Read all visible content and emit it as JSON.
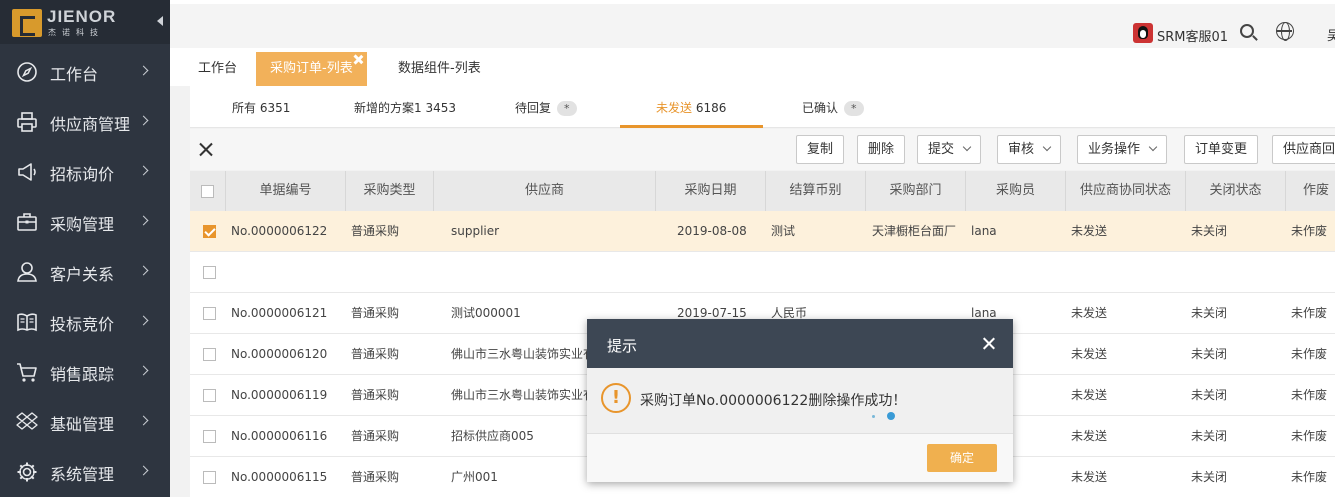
{
  "logo": {
    "name": "JIENOR",
    "subtitle": "杰诺科技"
  },
  "sidebar": {
    "items": [
      {
        "label": "工作台",
        "icon": "compass-icon"
      },
      {
        "label": "供应商管理",
        "icon": "printer-icon"
      },
      {
        "label": "招标询价",
        "icon": "megaphone-icon"
      },
      {
        "label": "采购管理",
        "icon": "briefcase-icon"
      },
      {
        "label": "客户关系",
        "icon": "user-icon"
      },
      {
        "label": "投标竞价",
        "icon": "book-icon"
      },
      {
        "label": "销售跟踪",
        "icon": "cart-icon"
      },
      {
        "label": "基础管理",
        "icon": "dropbox-icon"
      },
      {
        "label": "系统管理",
        "icon": "gear-icon"
      }
    ]
  },
  "topbar": {
    "user": "SRM客服01",
    "cut_text": "吴"
  },
  "pagetabs": {
    "tab1": "工作台",
    "tab2": "采购订单-列表",
    "tab3": "数据组件-列表"
  },
  "filters": {
    "all_label": "所有",
    "all_count": "6351",
    "new_label": "新增的方案1",
    "new_count": "3453",
    "reply_label": "待回复",
    "reply_badge": "*",
    "unsent_label": "未发送",
    "unsent_count": "6186",
    "confirmed_label": "已确认",
    "confirmed_badge": "*"
  },
  "toolbar": {
    "copy": "复制",
    "delete": "删除",
    "submit": "提交",
    "review": "审核",
    "business": "业务操作",
    "change": "订单变更",
    "supplier_cut": "供应商回"
  },
  "table": {
    "headers": [
      "单据编号",
      "采购类型",
      "供应商",
      "采购日期",
      "结算币别",
      "采购部门",
      "采购员",
      "供应商协同状态",
      "关闭状态",
      "作废"
    ],
    "rows": [
      [
        "No.0000006122",
        "普通采购",
        "supplier",
        "2019-08-08",
        "测试",
        "天津橱柜台面厂",
        "lana",
        "未发送",
        "未关闭",
        "未作废"
      ],
      [
        "",
        "",
        "",
        "",
        "",
        "",
        "",
        "",
        "",
        ""
      ],
      [
        "No.0000006121",
        "普通采购",
        "测试000001",
        "2019-07-15",
        "人民币",
        "",
        "lana",
        "未发送",
        "未关闭",
        "未作废"
      ],
      [
        "No.0000006120",
        "普通采购",
        "佛山市三水粤山装饰实业有",
        "",
        "",
        "",
        "",
        "未发送",
        "未关闭",
        "未作废"
      ],
      [
        "No.0000006119",
        "普通采购",
        "佛山市三水粤山装饰实业有",
        "",
        "",
        "",
        "",
        "未发送",
        "未关闭",
        "未作废"
      ],
      [
        "No.0000006116",
        "普通采购",
        "招标供应商005",
        "",
        "",
        "",
        "",
        "未发送",
        "未关闭",
        "未作废"
      ],
      [
        "No.0000006115",
        "普通采购",
        "广州001",
        "",
        "",
        "",
        "",
        "未发送",
        "未关闭",
        "未作废"
      ]
    ]
  },
  "dialog": {
    "title": "提示",
    "message": "采购订单No.0000006122删除操作成功！",
    "ok": "确定"
  },
  "colors": {
    "accent": "#e8952c",
    "sidebar": "#2e3540",
    "dialog_head": "#3d4754"
  }
}
